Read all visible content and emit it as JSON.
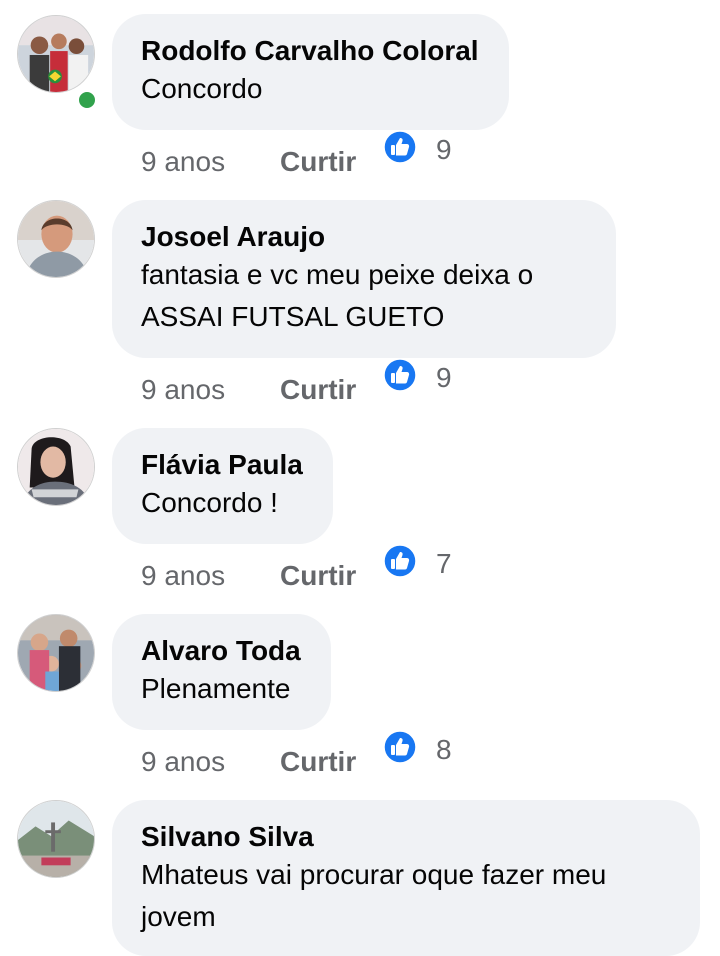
{
  "comments": [
    {
      "author": "Rodolfo Carvalho Coloral",
      "text": "Concordo",
      "time": "9 anos",
      "like_label": "Curtir",
      "like_count": "9",
      "online": true,
      "avatar_icon": "user-photo-group-icon"
    },
    {
      "author": "Josoel Araujo",
      "text": "fantasia e vc meu peixe deixa o ASSAI FUTSAL GUETO",
      "time": "9 anos",
      "like_label": "Curtir",
      "like_count": "9",
      "online": false,
      "avatar_icon": "user-photo-icon"
    },
    {
      "author": "Flávia Paula",
      "text": "Concordo !",
      "time": "9 anos",
      "like_label": "Curtir",
      "like_count": "7",
      "online": false,
      "avatar_icon": "user-photo-icon"
    },
    {
      "author": "Alvaro Toda",
      "text": "Plenamente",
      "time": "9 anos",
      "like_label": "Curtir",
      "like_count": "8",
      "online": false,
      "avatar_icon": "user-photo-family-icon"
    },
    {
      "author": "Silvano Silva",
      "text": "Mhateus vai procurar oque fazer meu jovem",
      "time": "",
      "like_label": "",
      "like_count": "",
      "online": false,
      "avatar_icon": "user-photo-landscape-icon"
    }
  ],
  "colors": {
    "bubble": "#f0f2f5",
    "meta_text": "#65676b",
    "like_blue": "#1877f2",
    "online_green": "#31a24c"
  }
}
